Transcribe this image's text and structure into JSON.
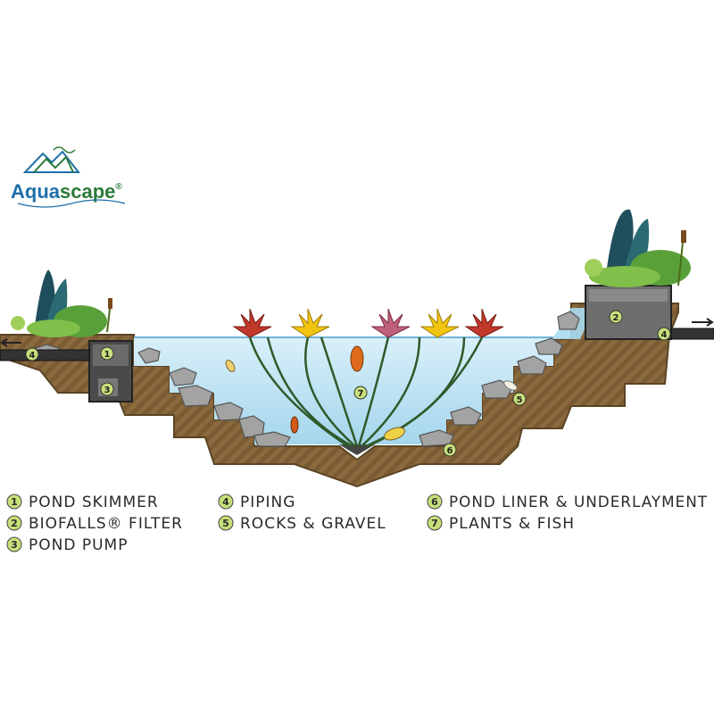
{
  "logo": {
    "part1": "Aqua",
    "part2": "scape",
    "mark": "®",
    "colors": {
      "aqua": "#1f6fa8",
      "scape": "#2c7a3a"
    }
  },
  "legend": [
    {
      "num": "1",
      "label": "POND SKIMMER"
    },
    {
      "num": "2",
      "label": "BIOFALLS® FILTER"
    },
    {
      "num": "3",
      "label": "POND PUMP"
    },
    {
      "num": "4",
      "label": "PIPING"
    },
    {
      "num": "5",
      "label": "ROCKS & GRAVEL"
    },
    {
      "num": "6",
      "label": "POND LINER & UNDERLAYMENT"
    },
    {
      "num": "7",
      "label": "PLANTS & FISH"
    }
  ],
  "callouts": [
    {
      "num": "1"
    },
    {
      "num": "2"
    },
    {
      "num": "3"
    },
    {
      "num": "4"
    },
    {
      "num": "4"
    },
    {
      "num": "5"
    },
    {
      "num": "6"
    },
    {
      "num": "7"
    }
  ],
  "colors": {
    "soil": "#8b6a3e",
    "soil_dark": "#5b4424",
    "water": "#bfe3f2",
    "water_dark": "#8fcbe6",
    "rock": "#9a9a9a",
    "legend_circle": "#c8e07a"
  }
}
